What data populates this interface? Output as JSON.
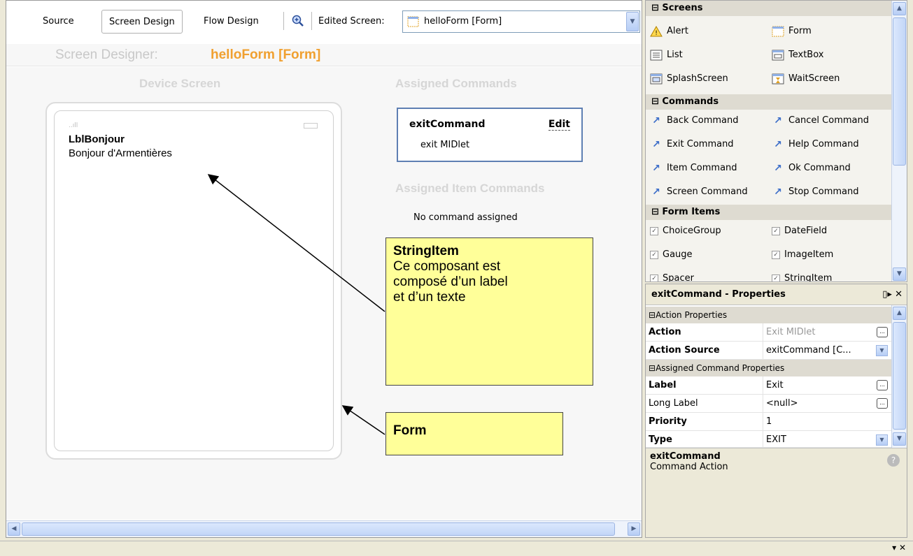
{
  "toolbar": {
    "tabs": [
      "Source",
      "Screen Design",
      "Flow Design"
    ],
    "edited_label": "Edited Screen:",
    "edited_value": "helloForm [Form]"
  },
  "designer": {
    "title_prefix": "Screen Designer:",
    "title_name": "helloForm [Form]",
    "device_screen_heading": "Device Screen",
    "assigned_commands_heading": "Assigned Commands",
    "assigned_item_commands_heading": "Assigned Item Commands",
    "device": {
      "signal": "..ıll",
      "item_label": "LblBonjour",
      "item_text": "Bonjour d'Armentières"
    },
    "command": {
      "name": "exitCommand",
      "edit": "Edit",
      "sub": "exit MIDlet"
    },
    "no_item_command": "No command assigned"
  },
  "notes": {
    "stringitem_title": "StringItem",
    "stringitem_body": [
      "Ce composant est",
      "composé d’un label",
      "et d’un texte"
    ],
    "form": "Form"
  },
  "palette": {
    "categories": [
      "Screens",
      "Commands",
      "Form Items"
    ],
    "screens": [
      "Alert",
      "Form",
      "List",
      "TextBox",
      "SplashScreen",
      "WaitScreen"
    ],
    "commands": [
      "Back Command",
      "Cancel Command",
      "Exit Command",
      "Help Command",
      "Item Command",
      "Ok Command",
      "Screen Command",
      "Stop Command"
    ],
    "form_items": [
      "ChoiceGroup",
      "DateField",
      "Gauge",
      "ImageItem",
      "Spacer",
      "StringItem"
    ]
  },
  "properties": {
    "title": "exitCommand - Properties",
    "sections": [
      "Action Properties",
      "Assigned Command Properties"
    ],
    "rows": [
      {
        "key": "Action",
        "value": "Exit MIDlet"
      },
      {
        "key": "Action Source",
        "value": "exitCommand [C..."
      },
      {
        "key": "Label",
        "value": "Exit"
      },
      {
        "key": "Long Label",
        "value": "<null>"
      },
      {
        "key": "Priority",
        "value": "1"
      },
      {
        "key": "Type",
        "value": "EXIT"
      }
    ],
    "desc_name": "exitCommand",
    "desc_text": "Command Action"
  },
  "colors": {
    "accent_orange": "#f0a030",
    "note_yellow": "#ffff99",
    "command_border": "#5e7fb3",
    "link_blue": "#3a6cc8"
  }
}
